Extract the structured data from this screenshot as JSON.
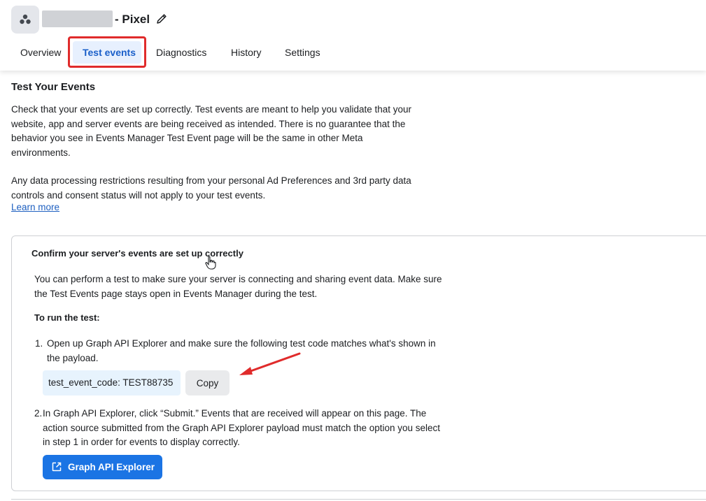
{
  "header": {
    "pixel_suffix": "- Pixel",
    "tabs": [
      {
        "label": "Overview"
      },
      {
        "label": "Test events"
      },
      {
        "label": "Diagnostics"
      },
      {
        "label": "History"
      },
      {
        "label": "Settings"
      }
    ]
  },
  "intro": {
    "title": "Test Your Events",
    "p1": "Check that your events are set up correctly. Test events are meant to help you validate that your website, app and server events are being received as intended. There is no guarantee that the behavior you see in Events Manager Test Event page will be the same in other Meta environments.",
    "p2": "Any data processing restrictions resulting from your personal Ad Preferences and 3rd party data controls and consent status will not apply to your test events.",
    "learn_more": "Learn more"
  },
  "card": {
    "title": "Confirm your server's events are set up correctly",
    "description": "You can perform a test to make sure your server is connecting and sharing event data. Make sure the Test Events page stays open in Events Manager during the test.",
    "run_label": "To run the test:",
    "step1_num": "1.",
    "step1": "Open up Graph API Explorer and make sure the following test code matches what's shown in the payload.",
    "test_code": "test_event_code: TEST88735",
    "copy_label": "Copy",
    "step2_num": "2.",
    "step2": "In Graph API Explorer, click “Submit.” Events that are received will appear on this page. The action source submitted from the Graph API Explorer payload must match the option you select in step 1 in order for events to display correctly.",
    "graph_button": "Graph API Explorer"
  },
  "colors": {
    "accent": "#1b74e4",
    "highlight": "#e02b2b",
    "active_tab_text": "#1a5fc9",
    "code_bg": "#e7f3fd"
  },
  "icons": [
    "pixel-icon",
    "pencil-icon",
    "cursor-icon",
    "arrow-icon",
    "external-link-icon"
  ]
}
